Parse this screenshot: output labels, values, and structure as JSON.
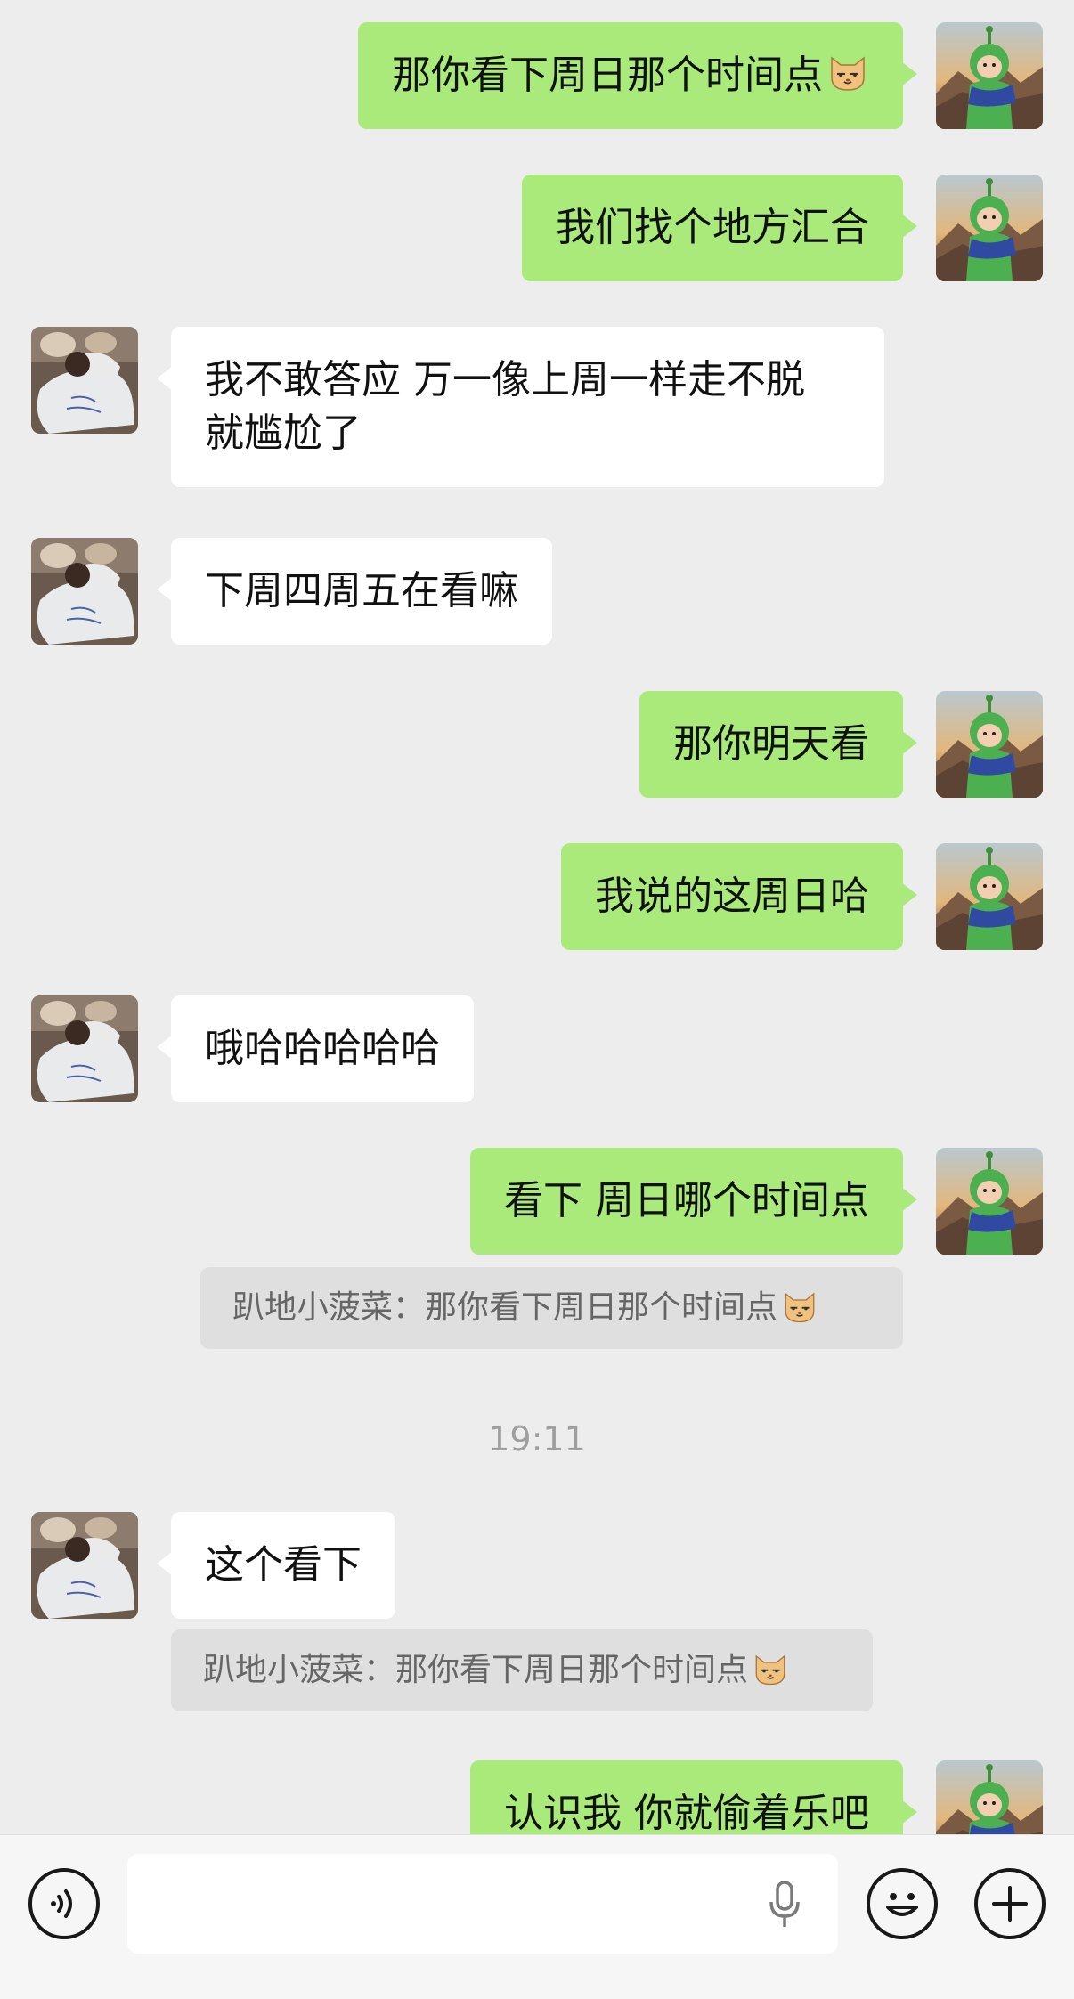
{
  "messages": [
    {
      "side": "me",
      "text": "那你看下周日那个时间点",
      "emoji": "cat-face-emoji"
    },
    {
      "side": "me",
      "text": "我们找个地方汇合"
    },
    {
      "side": "them",
      "lines": [
        "我不敢答应 万一像上周一样走不脱",
        "就尴尬了"
      ]
    },
    {
      "side": "them",
      "text": "下周四周五在看嘛"
    },
    {
      "side": "me",
      "text": "那你明天看"
    },
    {
      "side": "me",
      "text": "我说的这周日哈"
    },
    {
      "side": "them",
      "text": "哦哈哈哈哈哈"
    },
    {
      "side": "me",
      "text": "看下 周日哪个时间点",
      "quote": "趴地小菠菜：那你看下周日那个时间点"
    },
    {
      "side": "them",
      "text": "这个看下",
      "quote": "趴地小菠菜：那你看下周日那个时间点"
    },
    {
      "side": "me",
      "text": "认识我 你就偷着乐吧"
    }
  ],
  "timestamp": "19:11",
  "input_bar": {
    "voice_icon": "voice-icon",
    "mic_icon": "microphone-icon",
    "emoji_icon": "emoji-icon",
    "plus_icon": "plus-icon",
    "value": ""
  },
  "colors": {
    "background": "#ededed",
    "my_bubble": "#a9ea7a",
    "their_bubble": "#ffffff",
    "quote": "#dfdfdf"
  }
}
